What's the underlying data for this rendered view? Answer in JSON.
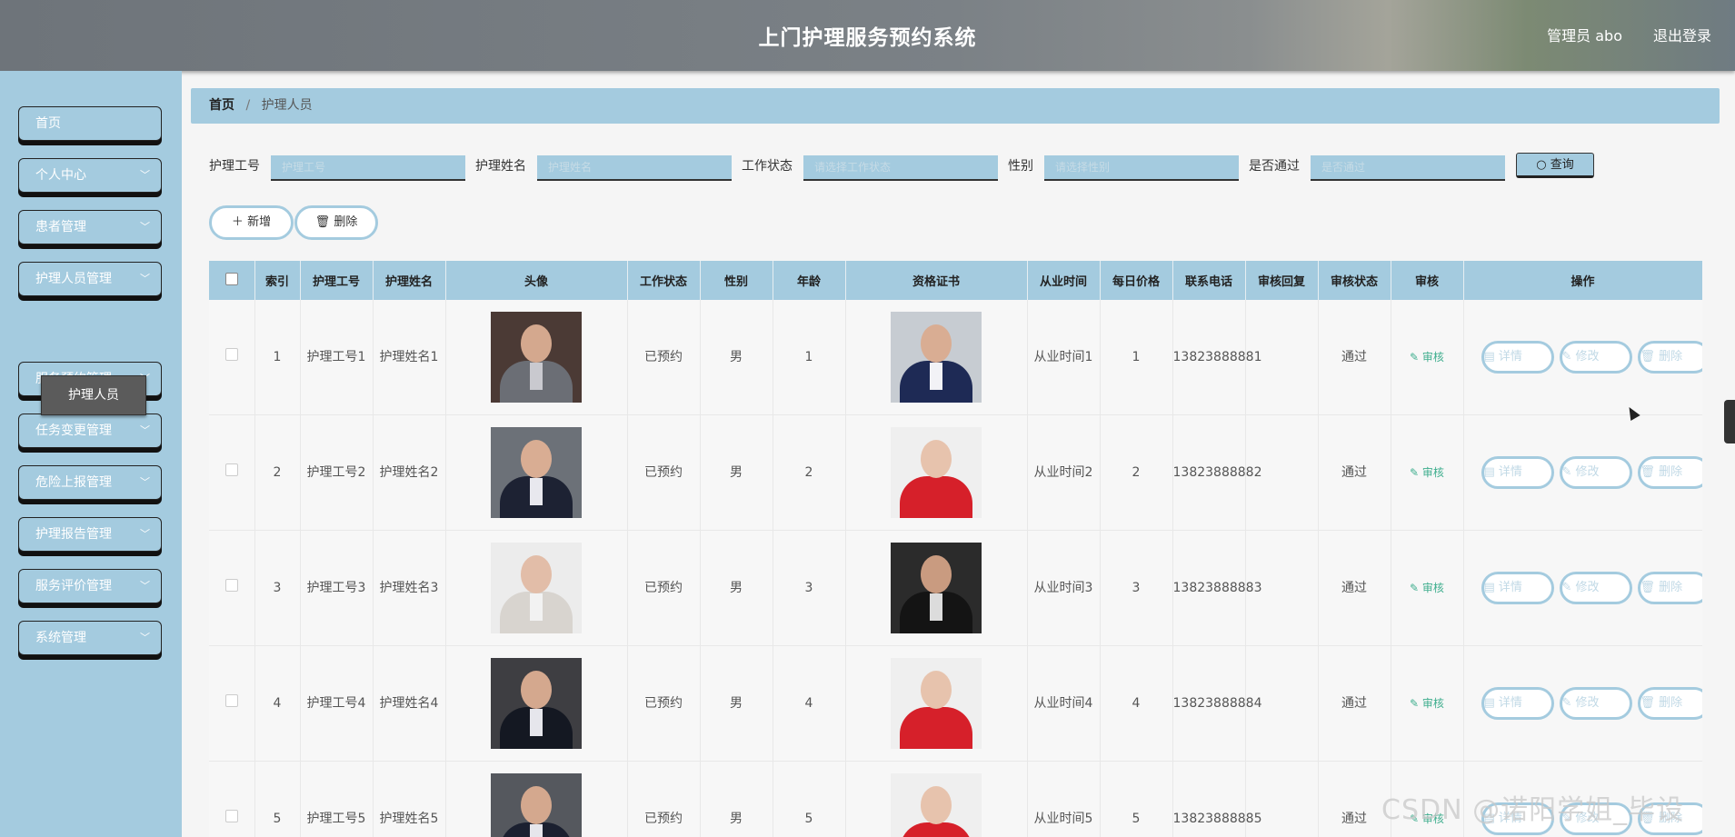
{
  "header": {
    "title": "上门护理服务预约系统",
    "user": "管理员 abo",
    "logout": "退出登录"
  },
  "sidebar": {
    "items": [
      {
        "label": "首页",
        "has_arrow": false
      },
      {
        "label": "个人中心",
        "has_arrow": true
      },
      {
        "label": "患者管理",
        "has_arrow": true
      },
      {
        "label": "护理人员管理",
        "has_arrow": true
      },
      {
        "label": "服务预约管理",
        "has_arrow": true
      },
      {
        "label": "任务变更管理",
        "has_arrow": true
      },
      {
        "label": "危险上报管理",
        "has_arrow": true
      },
      {
        "label": "护理报告管理",
        "has_arrow": true
      },
      {
        "label": "服务评价管理",
        "has_arrow": true
      },
      {
        "label": "系统管理",
        "has_arrow": true
      }
    ],
    "active_sub": "护理人员"
  },
  "breadcrumb": {
    "home": "首页",
    "sep": "/",
    "current": "护理人员"
  },
  "search": {
    "fields": [
      {
        "label": "护理工号",
        "placeholder": "护理工号"
      },
      {
        "label": "护理姓名",
        "placeholder": "护理姓名"
      },
      {
        "label": "工作状态",
        "placeholder": "请选择工作状态"
      },
      {
        "label": "性别",
        "placeholder": "请选择性别"
      },
      {
        "label": "是否通过",
        "placeholder": "是否通过"
      }
    ],
    "query_label": "查询"
  },
  "actions": {
    "add": "新增",
    "delete": "删除"
  },
  "table": {
    "headers": [
      "索引",
      "护理工号",
      "护理姓名",
      "头像",
      "工作状态",
      "性别",
      "年龄",
      "资格证书",
      "从业时间",
      "每日价格",
      "联系电话",
      "审核回复",
      "审核状态",
      "审核",
      "操作"
    ],
    "audit_link": "审核",
    "op_labels": {
      "detail": "详情",
      "edit": "修改",
      "delete": "删除"
    },
    "rows": [
      {
        "index": "1",
        "no": "护理工号1",
        "name": "护理姓名1",
        "status": "已预约",
        "gender": "男",
        "age": "1",
        "years": "从业时间1",
        "price": "1",
        "phone": "13823888881",
        "reply": "",
        "audit_status": "通过"
      },
      {
        "index": "2",
        "no": "护理工号2",
        "name": "护理姓名2",
        "status": "已预约",
        "gender": "男",
        "age": "2",
        "years": "从业时间2",
        "price": "2",
        "phone": "13823888882",
        "reply": "",
        "audit_status": "通过"
      },
      {
        "index": "3",
        "no": "护理工号3",
        "name": "护理姓名3",
        "status": "已预约",
        "gender": "男",
        "age": "3",
        "years": "从业时间3",
        "price": "3",
        "phone": "13823888883",
        "reply": "",
        "audit_status": "通过"
      },
      {
        "index": "4",
        "no": "护理工号4",
        "name": "护理姓名4",
        "status": "已预约",
        "gender": "男",
        "age": "4",
        "years": "从业时间4",
        "price": "4",
        "phone": "13823888884",
        "reply": "",
        "audit_status": "通过"
      },
      {
        "index": "5",
        "no": "护理工号5",
        "name": "护理姓名5",
        "status": "已预约",
        "gender": "男",
        "age": "5",
        "years": "从业时间5",
        "price": "5",
        "phone": "13823888885",
        "reply": "",
        "audit_status": "通过"
      }
    ]
  },
  "watermark": "CSDN @诺阳学姐_毕设"
}
